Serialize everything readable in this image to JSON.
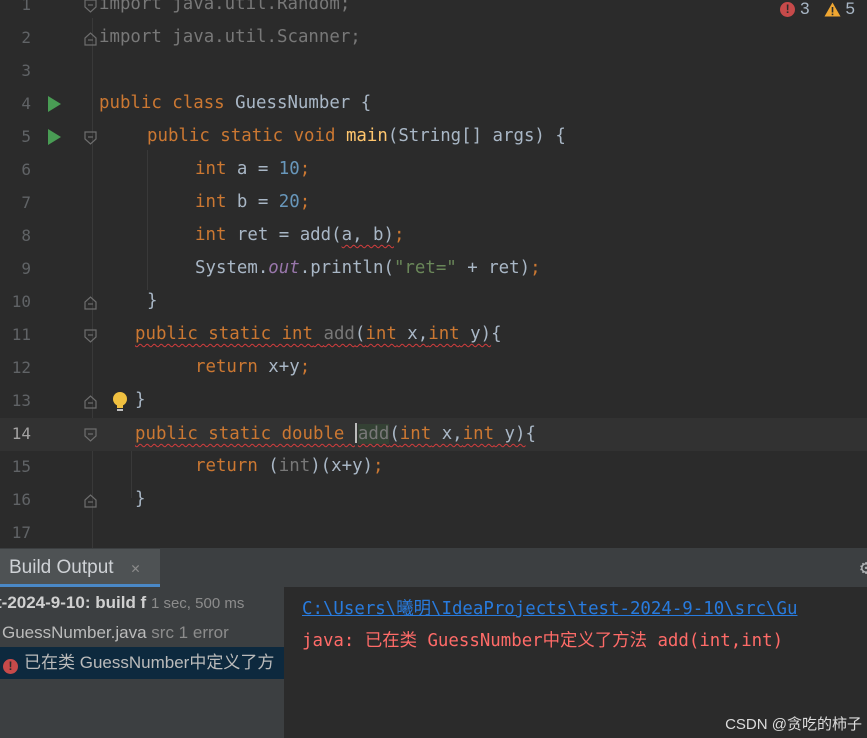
{
  "editor": {
    "indicators": {
      "errors": "3",
      "warnings": "5"
    },
    "lines": {
      "n1": "1",
      "n2": "2",
      "n3": "3",
      "n4": "4",
      "n5": "5",
      "n6": "6",
      "n7": "7",
      "n8": "8",
      "n9": "9",
      "n10": "10",
      "n11": "11",
      "n12": "12",
      "n13": "13",
      "n14": "14",
      "n15": "15",
      "n16": "16",
      "n17": "17"
    },
    "code": {
      "l1_kw": "import",
      "l1_rest": " java.util.Random;",
      "l2_kw": "import",
      "l2_rest": " java.util.Scanner;",
      "l4_kw": "public class",
      "l4_rest": " GuessNumber {",
      "l5_kw": "public static void",
      "l5_fn": "main",
      "l5_rest": "(String[] args) {",
      "l6_kw": "int",
      "l6_mid": " a = ",
      "l6_num": "10",
      "l6_semi": ";",
      "l7_kw": "int",
      "l7_mid": " b = ",
      "l7_num": "20",
      "l7_semi": ";",
      "l8_kw": "int",
      "l8_mid": " ret = add(",
      "l8_err": "a, b)",
      "l8_semi": ";",
      "l9_a": "System.",
      "l9_fld": "out",
      "l9_b": ".println(",
      "l9_str": "\"ret=\"",
      "l9_c": " + ret)",
      "l9_semi": ";",
      "l10": "}",
      "l11_kw1": "public static int",
      "l11_sp": " ",
      "l11_name": "add",
      "l11_p1": "(",
      "l11_kw2": "int",
      "l11_p2": " x,",
      "l11_kw3": "int",
      "l11_p3": " y)",
      "l11_end": "{",
      "l12_kw": "return",
      "l12_rest": " x+y",
      "l12_semi": ";",
      "l13": "}",
      "l14_kw1": "public static double",
      "l14_sp": " ",
      "l14_name": "add",
      "l14_p1": "(",
      "l14_kw2": "int",
      "l14_p2": " x,",
      "l14_kw3": "int",
      "l14_p3": " y)",
      "l14_end": "{",
      "l15_kw": "return",
      "l15_a": " (",
      "l15_int": "int",
      "l15_b": ")(x+y)",
      "l15_semi": ";",
      "l16": "}"
    }
  },
  "panel": {
    "tab_label": "Build Output",
    "tree": {
      "row1_name": "t-2024-9-10:",
      "row1_status": " build f",
      "row1_time": "1 sec, 500 ms",
      "row2_file": "GuessNumber.java",
      "row2_info": " src 1 error",
      "row3_msg": "已在类 GuessNumber中定义了方"
    },
    "console": {
      "path": "C:\\Users\\曦明\\IdeaProjects\\test-2024-9-10\\src\\Gu",
      "error": "java: 已在类 GuessNumber中定义了方法 add(int,int)"
    },
    "watermark": "CSDN @贪吃的柿子"
  },
  "colors": {
    "background": "#2b2b2b",
    "keyword": "#cc7832",
    "number": "#6897bb",
    "string": "#6a8759",
    "method": "#ffc66d",
    "field": "#9876aa",
    "error": "#ff6b68",
    "link": "#287bde",
    "run": "#499c54"
  }
}
